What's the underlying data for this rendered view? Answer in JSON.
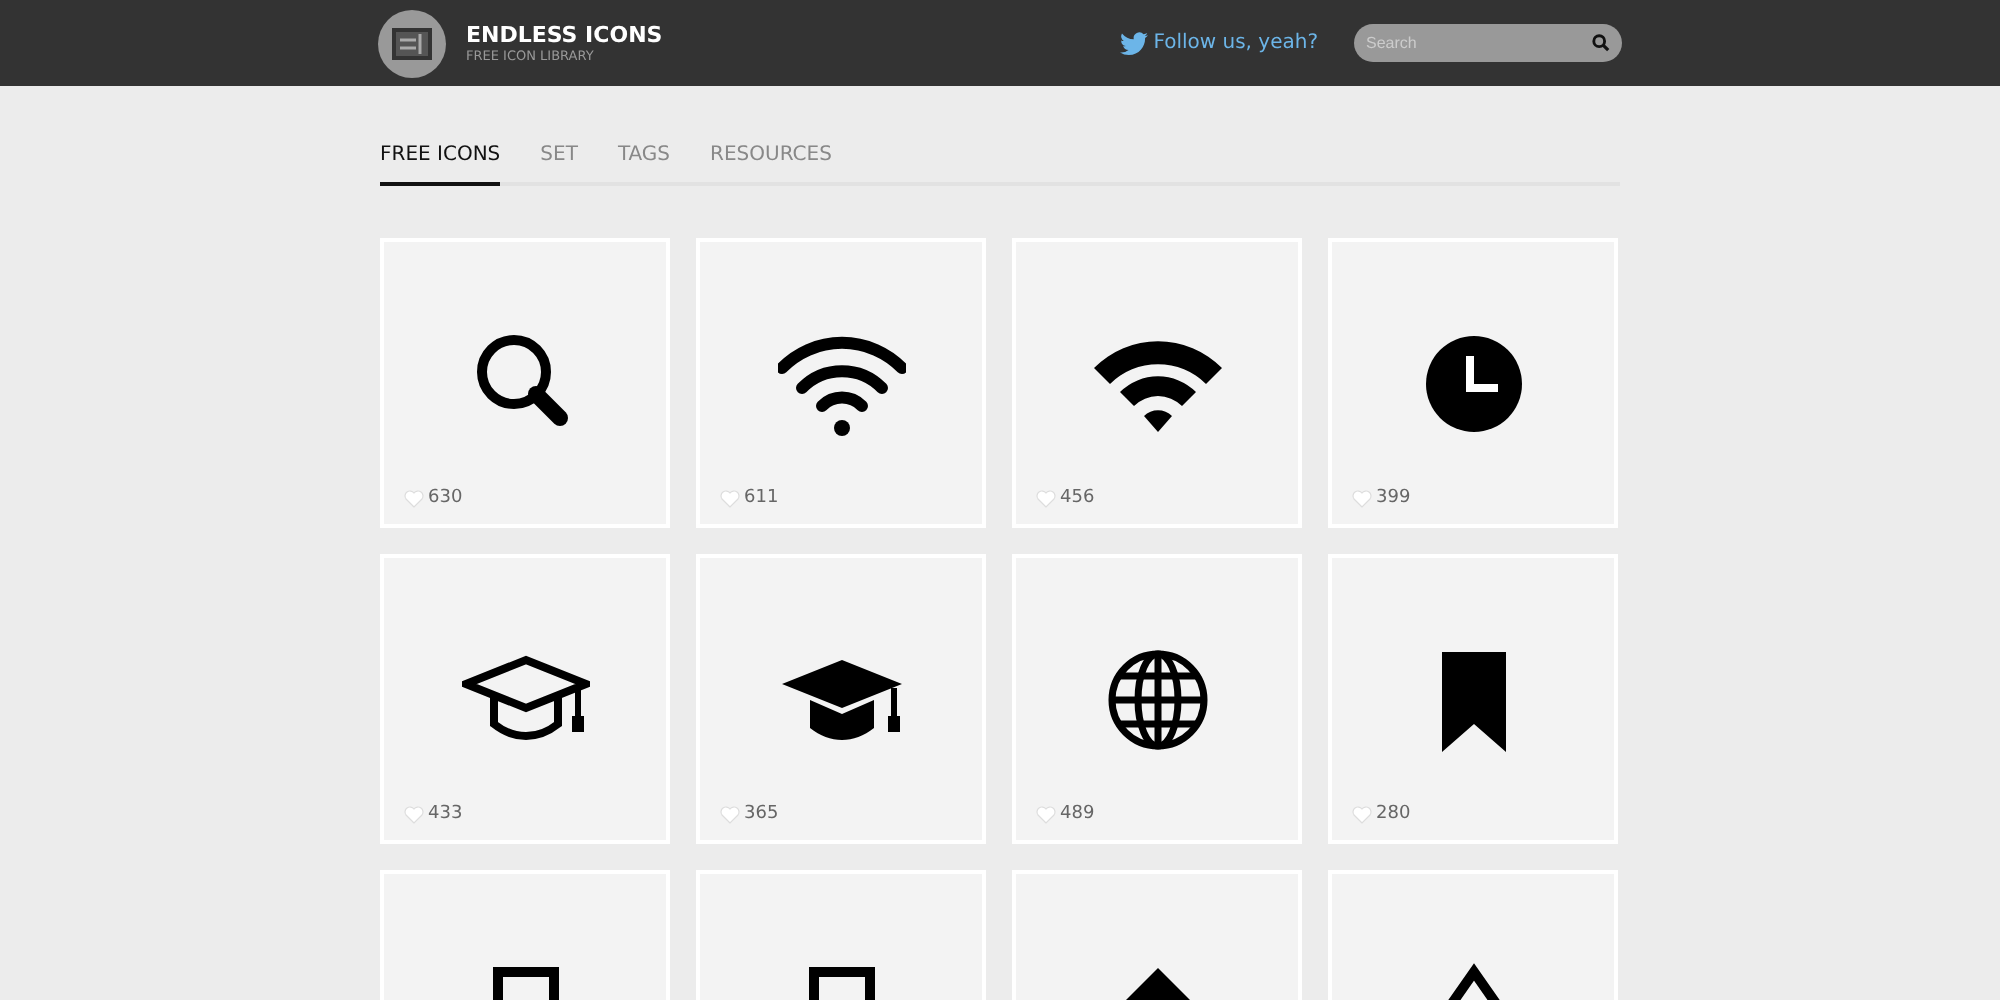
{
  "header": {
    "title": "ENDLESS ICONS",
    "subtitle": "FREE ICON LIBRARY",
    "follow": "Follow us, yeah?",
    "search": {
      "placeholder": "Search"
    }
  },
  "tabs": [
    {
      "label": "FREE ICONS",
      "selected": true
    },
    {
      "label": "SET",
      "selected": false
    },
    {
      "label": "TAGS",
      "selected": false
    },
    {
      "label": "RESOURCES",
      "selected": false
    }
  ],
  "cards": [
    {
      "kind": "search",
      "count": "630"
    },
    {
      "kind": "wifi",
      "count": "611"
    },
    {
      "kind": "wifi-solid",
      "count": "456"
    },
    {
      "kind": "clock",
      "count": "399"
    },
    {
      "kind": "cap-outline",
      "count": "433"
    },
    {
      "kind": "cap",
      "count": "365"
    },
    {
      "kind": "globe",
      "count": "489"
    },
    {
      "kind": "bookmark",
      "count": "280"
    },
    {
      "kind": "square"
    },
    {
      "kind": "square"
    },
    {
      "kind": "up-solid"
    },
    {
      "kind": "up-outline"
    }
  ]
}
